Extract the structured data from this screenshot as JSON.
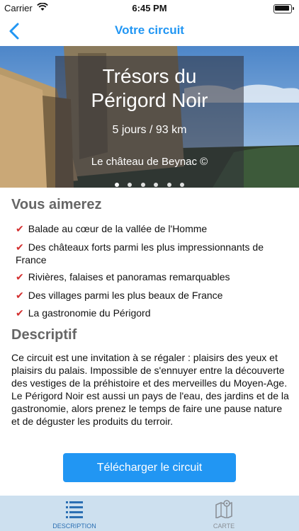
{
  "status_bar": {
    "carrier": "Carrier",
    "time": "6:45 PM"
  },
  "navbar": {
    "title": "Votre circuit"
  },
  "hero": {
    "title_line1": "Trésors du",
    "title_line2": "Périgord Noir",
    "subtitle": "5 jours / 93 km",
    "caption": "Le château de Beynac ©",
    "dot_count": 6
  },
  "highlights": {
    "title": "Vous aimerez",
    "items": [
      "Balade au cœur de la vallée de l'Homme",
      "Des châteaux forts parmi les plus impressionnants de France",
      "Rivières, falaises et panoramas remarquables",
      "Des villages parmi les plus beaux de France",
      "La gastronomie du Périgord"
    ]
  },
  "description": {
    "title": "Descriptif",
    "text": "Ce circuit est une invitation à se régaler : plaisirs des yeux et plaisirs du palais. Impossible de s'ennuyer entre la découverte des vestiges de la préhistoire et des merveilles du Moyen-Age. Le Périgord Noir est aussi un pays de l'eau, des jardins et de la gastronomie, alors prenez le temps de faire une pause nature et de déguster les produits du terroir."
  },
  "download_button": {
    "label": "Télécharger le circuit"
  },
  "tabbar": {
    "tabs": [
      {
        "label": "DESCRIPTION",
        "icon": "list-icon",
        "active": true
      },
      {
        "label": "CARTE",
        "icon": "map-icon",
        "active": false
      }
    ]
  },
  "colors": {
    "accent": "#2196f3",
    "check": "#d32f2f",
    "tabbar_bg": "#cde0ef"
  }
}
